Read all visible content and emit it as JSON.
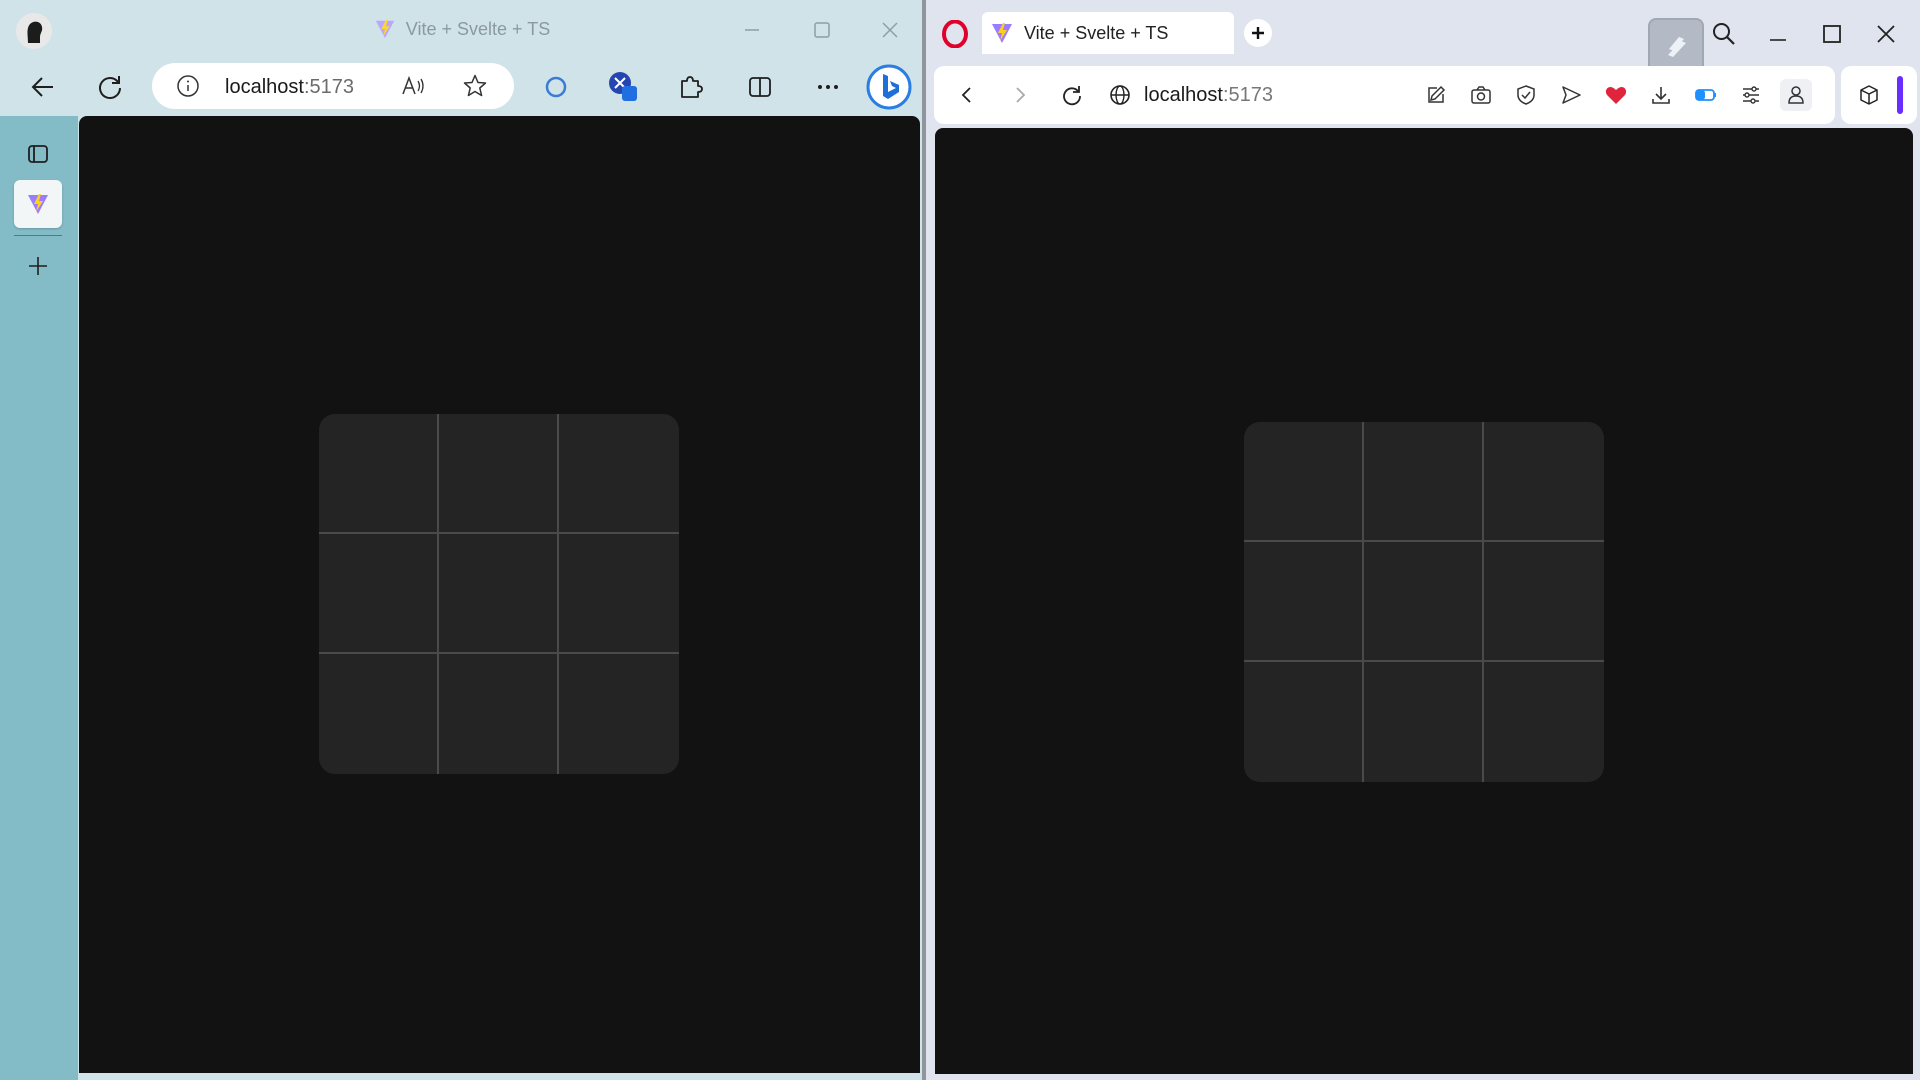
{
  "edge": {
    "title": "Vite + Svelte + TS",
    "address": {
      "host": "localhost",
      "port": ":5173"
    },
    "toolbar_icons": [
      "back-icon",
      "refresh-icon",
      "info-icon",
      "read-aloud-icon",
      "favorite-star-icon",
      "edge-sync-icon",
      "extension-badge-icon",
      "extensions-puzzle-icon",
      "split-screen-icon",
      "more-icon",
      "bing-copilot-icon"
    ],
    "sidebar_icons": [
      "tab-actions-icon",
      "vite-tab-icon",
      "new-tab-plus-icon"
    ],
    "colors": {
      "frame": "#cfe3e8",
      "sidebar": "#83bcc6",
      "page_bg": "#121212"
    }
  },
  "opera": {
    "tab_title": "Vite + Svelte + TS",
    "address": {
      "host": "localhost",
      "port": ":5173"
    },
    "toolbar_icons": [
      "back-icon",
      "forward-icon",
      "refresh-icon",
      "globe-icon",
      "edit-icon",
      "camera-icon",
      "shield-icon",
      "send-icon",
      "heart-icon",
      "download-icon",
      "battery-icon",
      "easy-setup-icon",
      "profile-icon",
      "cube-icon"
    ],
    "colors": {
      "frame": "#dfe4ee",
      "accent": "#e0002a",
      "page_bg": "#121212"
    }
  },
  "board": {
    "rows": 3,
    "cols": 3,
    "cells": [
      "",
      "",
      "",
      "",
      "",
      "",
      "",
      "",
      ""
    ],
    "colors": {
      "board_bg": "#242424",
      "grid_line": "#4a4a4a"
    }
  }
}
